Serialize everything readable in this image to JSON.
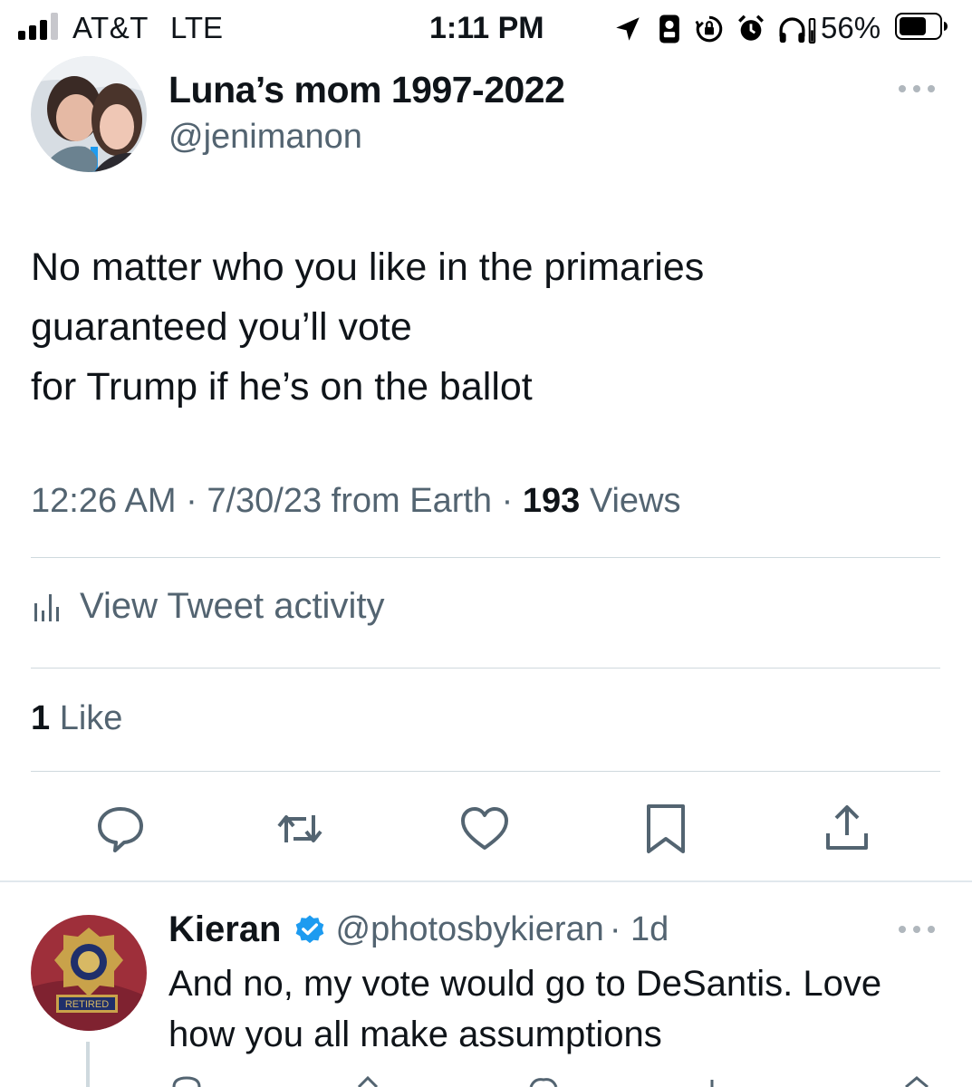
{
  "status_bar": {
    "carrier": "AT&T",
    "network": "LTE",
    "time": "1:11 PM",
    "battery_percent": "56%",
    "icons": [
      "location-arrow-icon",
      "portrait-badge-icon",
      "orientation-lock-icon",
      "alarm-icon",
      "headphones-icon"
    ]
  },
  "tweet": {
    "author_name": "Luna’s mom 1997-2022",
    "author_handle": "@jenimanon",
    "text_lines": [
      "No matter who you like in the primaries",
      "guaranteed you’ll vote",
      "for Trump if he’s on the ballot"
    ],
    "meta": {
      "time": "12:26 AM",
      "separator": "·",
      "date_source": "7/30/23 from Earth",
      "views_count": "193",
      "views_label": "Views"
    },
    "activity_label": "View Tweet activity",
    "likes_count": "1",
    "likes_label": "Like",
    "actions": [
      "reply-icon",
      "retweet-icon",
      "like-icon",
      "bookmark-icon",
      "share-icon"
    ]
  },
  "reply": {
    "author_name": "Kieran",
    "author_handle": "@photosbykieran",
    "time_ago": "· 1d",
    "text": "And no, my vote would go to DeSantis. Love how you all make assumptions",
    "badge_text": "RETIRED"
  },
  "colors": {
    "text_primary": "#0f1419",
    "text_secondary": "#536471",
    "divider": "#cfd9de",
    "verified_blue": "#1d9bf0"
  }
}
